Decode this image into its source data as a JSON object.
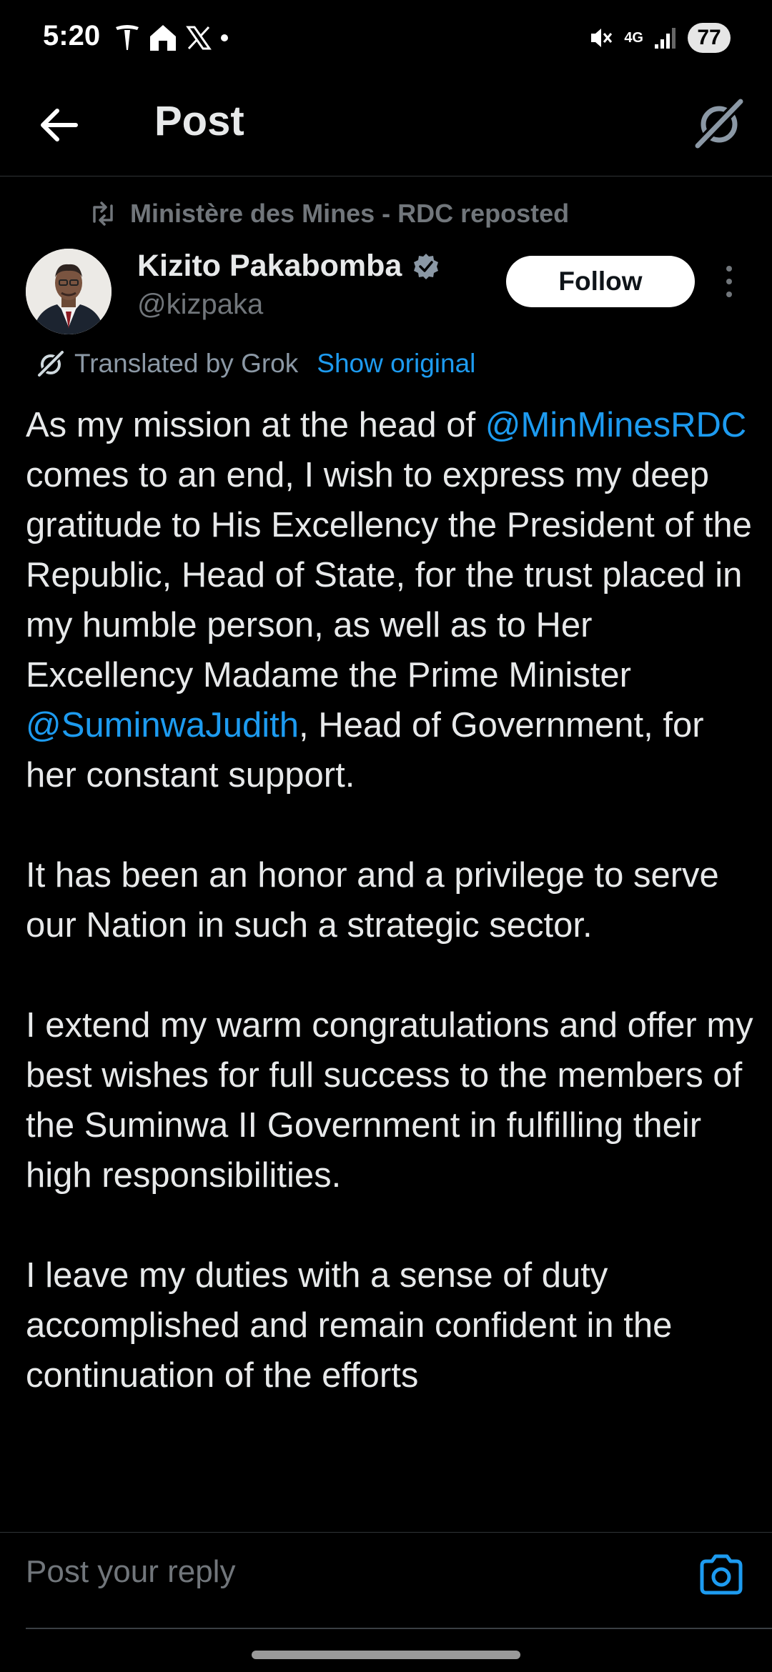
{
  "status_bar": {
    "time": "5:20",
    "network": "4G",
    "battery": "77"
  },
  "header": {
    "title": "Post"
  },
  "repost": {
    "text": "Ministère des Mines - RDC reposted"
  },
  "author": {
    "name": "Kizito Pakabomba",
    "handle": "@kizpaka",
    "verified": true
  },
  "follow_label": "Follow",
  "translation": {
    "label": "Translated by Grok",
    "show_original": "Show original"
  },
  "post": {
    "p1_a": "As my mission at the head of ",
    "p1_mention1": "@MinMinesRDC",
    "p1_b": " comes to an end, I wish to express my deep gratitude to His Excellency the President of the Republic, Head of State, for the trust placed in my humble person, as well as to Her Excellency Madame the Prime Minister ",
    "p1_mention2": "@SuminwaJudith",
    "p1_c": ", Head of Government, for her constant support.",
    "p2": "It has been an honor and a privilege to serve our Nation in such a strategic sector.",
    "p3": "I extend my warm congratulations and offer my best wishes for full success to the members of the Suminwa II Government in fulfilling their high responsibilities.",
    "p4": "I leave my duties with a sense of duty accomplished and remain confident in the continuation of the efforts"
  },
  "reply": {
    "placeholder": "Post your reply"
  },
  "colors": {
    "background": "#000000",
    "text": "#e7e9ea",
    "secondary": "#71767b",
    "accent": "#1d9bf0"
  },
  "icons": [
    "back-arrow-icon",
    "grok-icon",
    "repost-icon",
    "verified-badge-icon",
    "more-vertical-icon",
    "camera-icon"
  ]
}
